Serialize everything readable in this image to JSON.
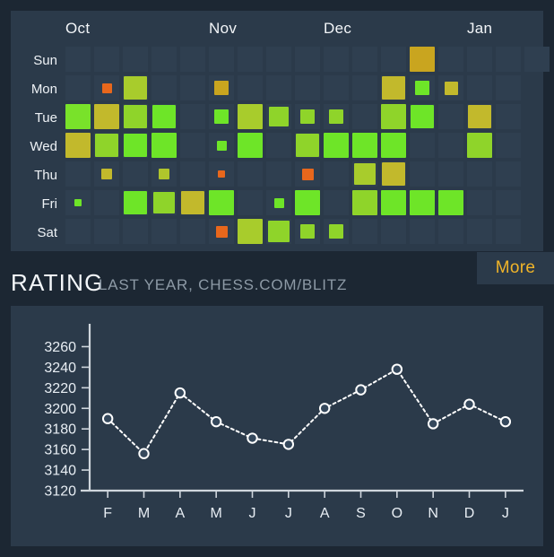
{
  "colors": {
    "page_background": "#1c2733",
    "panel_background": "#2b3a4a",
    "empty_cell": "#2f3f50",
    "accent_gold": "#f0b429",
    "text_primary": "#f2f5f8",
    "text_muted": "#8d9aa6",
    "axis": "#cfd6dd",
    "series_line": "#ffffff",
    "marker_fill": "#35485c"
  },
  "activity": {
    "months": [
      {
        "label": "Oct",
        "col": 0
      },
      {
        "label": "Nov",
        "col": 5
      },
      {
        "label": "Dec",
        "col": 9
      },
      {
        "label": "Jan",
        "col": 14
      }
    ],
    "days": [
      "Sun",
      "Mon",
      "Tue",
      "Wed",
      "Thu",
      "Fri",
      "Sat"
    ],
    "columns": 17,
    "legend_colors": [
      "#e8671c",
      "#c4b02a",
      "#a8c52c",
      "#8ed42a",
      "#6ee528"
    ],
    "cells": [
      {
        "row": 0,
        "col": 12,
        "size": 28,
        "color": "#c9a51f"
      },
      {
        "row": 0,
        "col": 16,
        "size": 28,
        "color": "#2f3f50"
      },
      {
        "row": 1,
        "col": 1,
        "size": 11,
        "color": "#e8671c"
      },
      {
        "row": 1,
        "col": 2,
        "size": 26,
        "color": "#a8cc2c"
      },
      {
        "row": 1,
        "col": 5,
        "size": 16,
        "color": "#c9a51f"
      },
      {
        "row": 1,
        "col": 11,
        "size": 26,
        "color": "#c2b92c"
      },
      {
        "row": 1,
        "col": 12,
        "size": 16,
        "color": "#6ee528"
      },
      {
        "row": 1,
        "col": 13,
        "size": 15,
        "color": "#c2b92c"
      },
      {
        "row": 2,
        "col": 0,
        "size": 28,
        "color": "#79e22a"
      },
      {
        "row": 2,
        "col": 1,
        "size": 28,
        "color": "#c2b92c"
      },
      {
        "row": 2,
        "col": 2,
        "size": 26,
        "color": "#8fd42a"
      },
      {
        "row": 2,
        "col": 3,
        "size": 26,
        "color": "#6ee528"
      },
      {
        "row": 2,
        "col": 5,
        "size": 16,
        "color": "#6ee528"
      },
      {
        "row": 2,
        "col": 6,
        "size": 28,
        "color": "#a8cc2c"
      },
      {
        "row": 2,
        "col": 7,
        "size": 22,
        "color": "#8fd42a"
      },
      {
        "row": 2,
        "col": 8,
        "size": 16,
        "color": "#8fd42a"
      },
      {
        "row": 2,
        "col": 9,
        "size": 16,
        "color": "#8fd42a"
      },
      {
        "row": 2,
        "col": 11,
        "size": 28,
        "color": "#8fd42a"
      },
      {
        "row": 2,
        "col": 12,
        "size": 26,
        "color": "#6ee528"
      },
      {
        "row": 2,
        "col": 14,
        "size": 26,
        "color": "#c2b92c"
      },
      {
        "row": 3,
        "col": 0,
        "size": 28,
        "color": "#c2b92c"
      },
      {
        "row": 3,
        "col": 1,
        "size": 26,
        "color": "#8fd42a"
      },
      {
        "row": 3,
        "col": 2,
        "size": 26,
        "color": "#6ee528"
      },
      {
        "row": 3,
        "col": 3,
        "size": 28,
        "color": "#6ee528"
      },
      {
        "row": 3,
        "col": 5,
        "size": 11,
        "color": "#6ee528"
      },
      {
        "row": 3,
        "col": 6,
        "size": 28,
        "color": "#6ee528"
      },
      {
        "row": 3,
        "col": 8,
        "size": 26,
        "color": "#8fd42a"
      },
      {
        "row": 3,
        "col": 9,
        "size": 28,
        "color": "#6ee528"
      },
      {
        "row": 3,
        "col": 10,
        "size": 28,
        "color": "#6ee528"
      },
      {
        "row": 3,
        "col": 11,
        "size": 28,
        "color": "#6ee528"
      },
      {
        "row": 3,
        "col": 14,
        "size": 28,
        "color": "#8fd42a"
      },
      {
        "row": 4,
        "col": 1,
        "size": 12,
        "color": "#c2b92c"
      },
      {
        "row": 4,
        "col": 3,
        "size": 12,
        "color": "#b0c52c"
      },
      {
        "row": 4,
        "col": 5,
        "size": 8,
        "color": "#e8671c"
      },
      {
        "row": 4,
        "col": 8,
        "size": 13,
        "color": "#e8671c"
      },
      {
        "row": 4,
        "col": 10,
        "size": 24,
        "color": "#a8cc2c"
      },
      {
        "row": 4,
        "col": 11,
        "size": 26,
        "color": "#c2b92c"
      },
      {
        "row": 5,
        "col": 0,
        "size": 8,
        "color": "#6ee528"
      },
      {
        "row": 5,
        "col": 2,
        "size": 26,
        "color": "#6ee528"
      },
      {
        "row": 5,
        "col": 3,
        "size": 24,
        "color": "#8fd42a"
      },
      {
        "row": 5,
        "col": 4,
        "size": 26,
        "color": "#c2b92c"
      },
      {
        "row": 5,
        "col": 5,
        "size": 28,
        "color": "#6ee528"
      },
      {
        "row": 5,
        "col": 7,
        "size": 11,
        "color": "#6ee528"
      },
      {
        "row": 5,
        "col": 8,
        "size": 28,
        "color": "#6ee528"
      },
      {
        "row": 5,
        "col": 10,
        "size": 28,
        "color": "#8fd42a"
      },
      {
        "row": 5,
        "col": 11,
        "size": 28,
        "color": "#6ee528"
      },
      {
        "row": 5,
        "col": 12,
        "size": 28,
        "color": "#6ee528"
      },
      {
        "row": 5,
        "col": 13,
        "size": 28,
        "color": "#6ee528"
      },
      {
        "row": 6,
        "col": 5,
        "size": 13,
        "color": "#e8671c"
      },
      {
        "row": 6,
        "col": 6,
        "size": 28,
        "color": "#a8cc2c"
      },
      {
        "row": 6,
        "col": 7,
        "size": 24,
        "color": "#8fd42a"
      },
      {
        "row": 6,
        "col": 8,
        "size": 16,
        "color": "#8fd42a"
      },
      {
        "row": 6,
        "col": 9,
        "size": 16,
        "color": "#8fd42a"
      }
    ]
  },
  "rating_section": {
    "title": "RATING",
    "subtitle": "LAST YEAR, CHESS.COM/BLITZ",
    "more_label": "More"
  },
  "chart_data": {
    "type": "line",
    "title": "RATING",
    "subtitle": "LAST YEAR, CHESS.COM/BLITZ",
    "xlabel": "",
    "ylabel": "",
    "categories": [
      "F",
      "M",
      "A",
      "M",
      "J",
      "J",
      "A",
      "S",
      "O",
      "N",
      "D",
      "J"
    ],
    "values": [
      3190,
      3156,
      3215,
      3187,
      3171,
      3165,
      3200,
      3218,
      3238,
      3185,
      3204,
      3187
    ],
    "ylim": [
      3120,
      3270
    ],
    "yticks": [
      3120,
      3140,
      3160,
      3180,
      3200,
      3220,
      3240,
      3260
    ],
    "grid": false,
    "legend": null,
    "marker": "circle",
    "linestyle": "dotted"
  }
}
